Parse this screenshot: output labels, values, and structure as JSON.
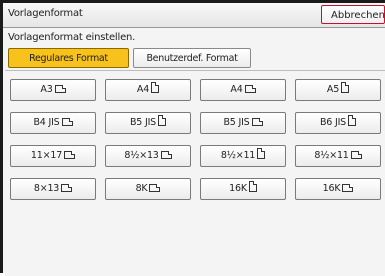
{
  "header": {
    "title": "Vorlagenformat",
    "cancel_label": "Abbrechen"
  },
  "instruction": "Vorlagenformat einstellen.",
  "tabs": [
    {
      "label": "Regulares Format",
      "selected": true
    },
    {
      "label": "Benutzerdef. Format",
      "selected": false
    }
  ],
  "formats": [
    [
      {
        "label": "A3",
        "orientation": "landscape"
      },
      {
        "label": "A4",
        "orientation": "portrait"
      },
      {
        "label": "A4",
        "orientation": "landscape"
      },
      {
        "label": "A5",
        "orientation": "portrait"
      }
    ],
    [
      {
        "label": "B4 JIS",
        "orientation": "landscape"
      },
      {
        "label": "B5 JIS",
        "orientation": "portrait"
      },
      {
        "label": "B5 JIS",
        "orientation": "landscape"
      },
      {
        "label": "B6 JIS",
        "orientation": "portrait"
      }
    ],
    [
      {
        "label": "11×17",
        "orientation": "landscape"
      },
      {
        "label": "8½×13",
        "orientation": "landscape"
      },
      {
        "label": "8½×11",
        "orientation": "portrait"
      },
      {
        "label": "8½×11",
        "orientation": "landscape"
      }
    ],
    [
      {
        "label": "8×13",
        "orientation": "landscape"
      },
      {
        "label": "8K",
        "orientation": "landscape"
      },
      {
        "label": "16K",
        "orientation": "portrait"
      },
      {
        "label": "16K",
        "orientation": "landscape"
      }
    ]
  ],
  "colors": {
    "selected_tab": "#f6c21b",
    "cancel_border": "#c8102e"
  }
}
